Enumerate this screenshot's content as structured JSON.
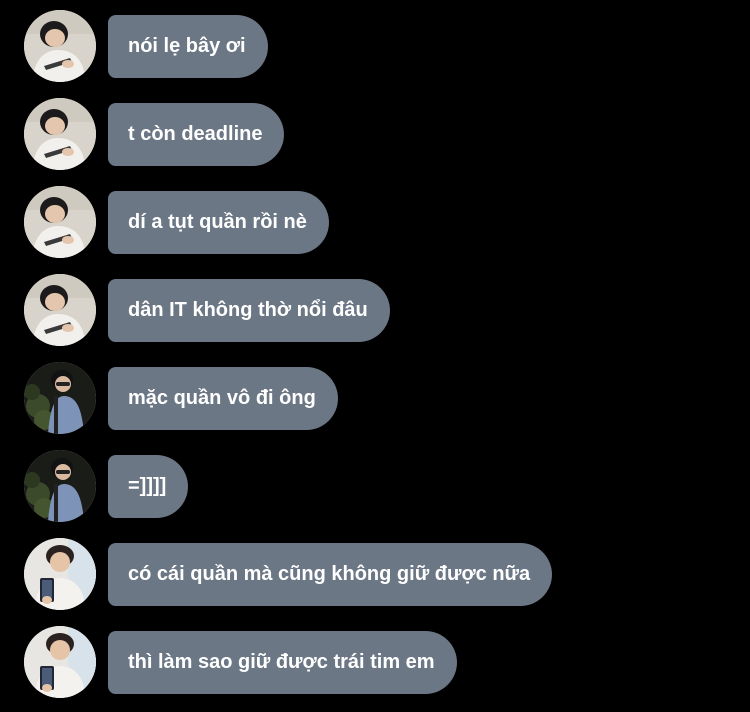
{
  "colors": {
    "background": "#000000",
    "bubble": "#6b7785",
    "bubble_text": "#ffffff"
  },
  "messages": [
    {
      "text": "nói lẹ bây ơi",
      "avatar": "user-a-avatar"
    },
    {
      "text": "t còn deadline",
      "avatar": "user-a-avatar"
    },
    {
      "text": "dí a tụt quần rồi nè",
      "avatar": "user-a-avatar"
    },
    {
      "text": "dân IT không thờ nổi đâu",
      "avatar": "user-a-avatar"
    },
    {
      "text": "mặc quần vô đi ông",
      "avatar": "user-b-avatar"
    },
    {
      "text": "=]]]]",
      "avatar": "user-b-avatar"
    },
    {
      "text": "có cái quần mà cũng không giữ được nữa",
      "avatar": "user-c-avatar"
    },
    {
      "text": "thì làm sao giữ được trái tim em",
      "avatar": "user-c-avatar"
    }
  ]
}
